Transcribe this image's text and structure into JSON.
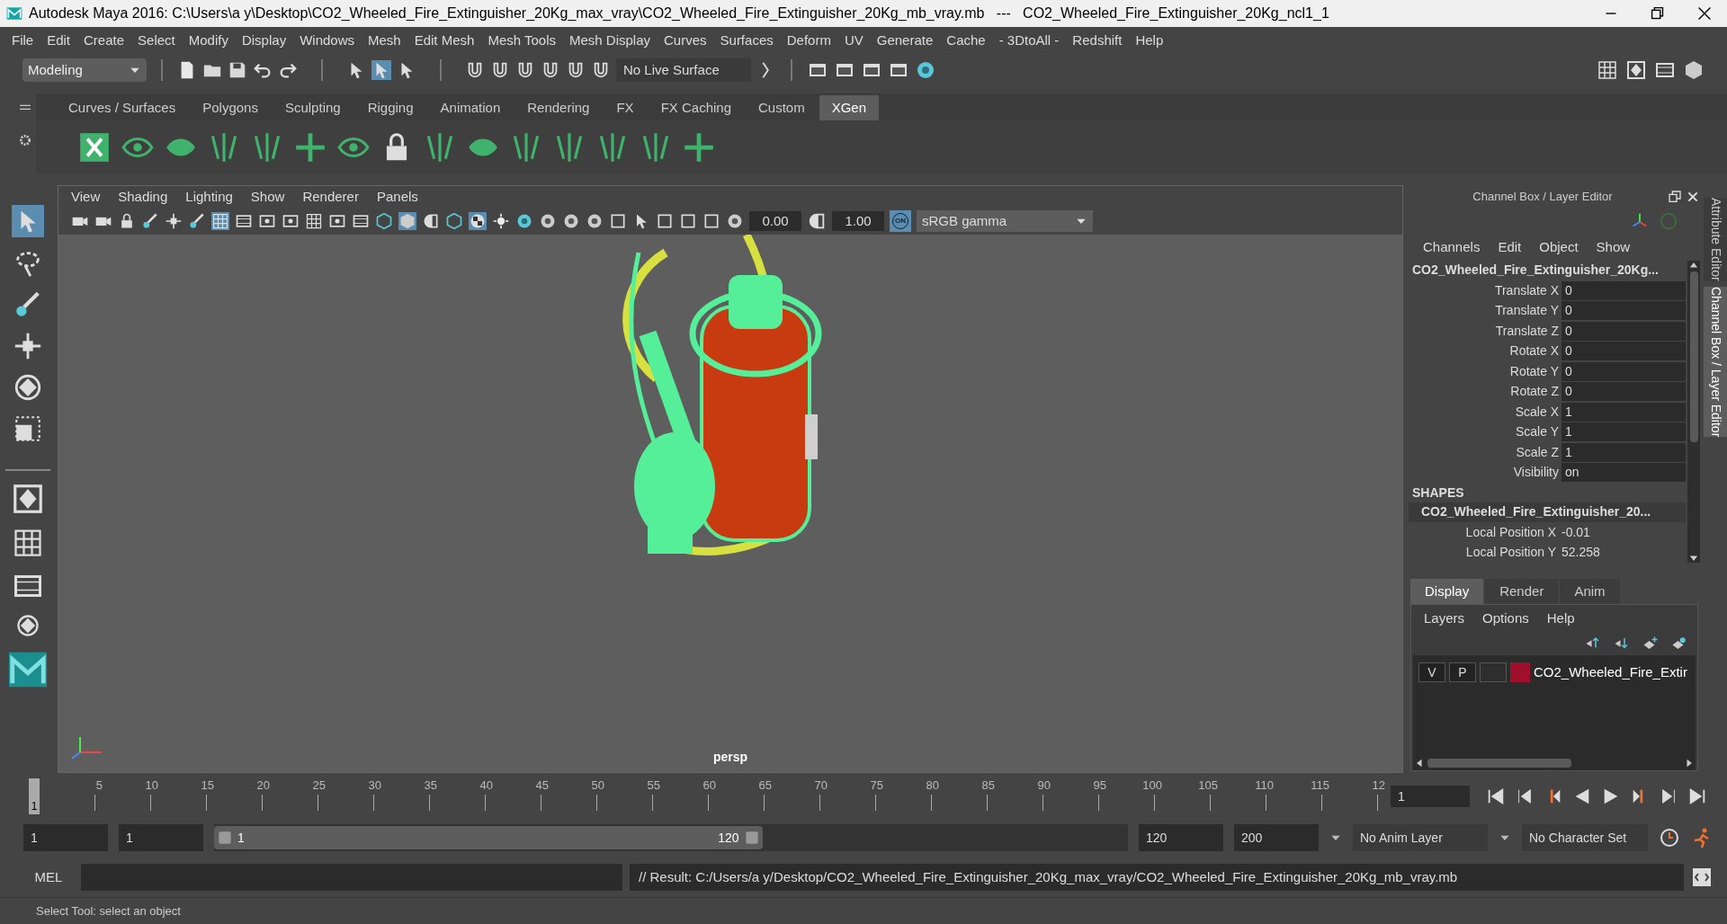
{
  "window": {
    "title": "Autodesk Maya 2016: C:\\Users\\a y\\Desktop\\CO2_Wheeled_Fire_Extinguisher_20Kg_max_vray\\CO2_Wheeled_Fire_Extinguisher_20Kg_mb_vray.mb   ---   CO2_Wheeled_Fire_Extinguisher_20Kg_ncl1_1"
  },
  "menu_bar": [
    "File",
    "Edit",
    "Create",
    "Select",
    "Modify",
    "Display",
    "Windows",
    "Mesh",
    "Edit Mesh",
    "Mesh Tools",
    "Mesh Display",
    "Curves",
    "Surfaces",
    "Deform",
    "UV",
    "Generate",
    "Cache",
    "- 3DtoAll -",
    "Redshift",
    "Help"
  ],
  "status_line": {
    "mode": "Modeling",
    "live_surface": "No Live Surface"
  },
  "shelf": {
    "tabs": [
      {
        "label": "Curves / Surfaces",
        "selected": false
      },
      {
        "label": "Polygons",
        "selected": false
      },
      {
        "label": "Sculpting",
        "selected": false
      },
      {
        "label": "Rigging",
        "selected": false
      },
      {
        "label": "Animation",
        "selected": false
      },
      {
        "label": "Rendering",
        "selected": false
      },
      {
        "label": "FX",
        "selected": false
      },
      {
        "label": "FX Caching",
        "selected": false
      },
      {
        "label": "Custom",
        "selected": false
      },
      {
        "label": "XGen",
        "selected": true
      }
    ]
  },
  "viewport": {
    "menu": [
      "View",
      "Shading",
      "Lighting",
      "Show",
      "Renderer",
      "Panels"
    ],
    "exposure": "0.00",
    "gamma": "1.00",
    "color_management": "ON",
    "color_space": "sRGB gamma",
    "camera": "persp"
  },
  "channel_box": {
    "title": "Channel Box / Layer Editor",
    "menu": [
      "Channels",
      "Edit",
      "Object",
      "Show"
    ],
    "object_name": "CO2_Wheeled_Fire_Extinguisher_20Kg...",
    "channels": [
      {
        "name": "Translate X",
        "value": "0"
      },
      {
        "name": "Translate Y",
        "value": "0"
      },
      {
        "name": "Translate Z",
        "value": "0"
      },
      {
        "name": "Rotate X",
        "value": "0"
      },
      {
        "name": "Rotate Y",
        "value": "0"
      },
      {
        "name": "Rotate Z",
        "value": "0"
      },
      {
        "name": "Scale X",
        "value": "1"
      },
      {
        "name": "Scale Y",
        "value": "1"
      },
      {
        "name": "Scale Z",
        "value": "1"
      },
      {
        "name": "Visibility",
        "value": "on"
      }
    ],
    "shapes_header": "SHAPES",
    "shape_name": "CO2_Wheeled_Fire_Extinguisher_20...",
    "shape_channels": [
      {
        "name": "Local Position X",
        "value": "-0.01"
      },
      {
        "name": "Local Position Y",
        "value": "52.258"
      }
    ]
  },
  "side_tabs": [
    {
      "label": "Attribute Editor",
      "selected": false
    },
    {
      "label": "Channel Box / Layer Editor",
      "selected": true
    }
  ],
  "layer_editor": {
    "tabs": [
      {
        "label": "Display",
        "selected": true
      },
      {
        "label": "Render",
        "selected": false
      },
      {
        "label": "Anim",
        "selected": false
      }
    ],
    "menu": [
      "Layers",
      "Options",
      "Help"
    ],
    "layers": [
      {
        "visible": "V",
        "playback": "P",
        "color": "#a0102a",
        "name": "CO2_Wheeled_Fire_Extir"
      }
    ]
  },
  "timeline": {
    "ticks": [
      "5",
      "10",
      "15",
      "20",
      "25",
      "30",
      "35",
      "40",
      "45",
      "50",
      "55",
      "60",
      "65",
      "70",
      "75",
      "80",
      "85",
      "90",
      "95",
      "100",
      "105",
      "110",
      "115",
      "12"
    ],
    "current_marker": "1",
    "current_frame": "1"
  },
  "range": {
    "level": 0.6,
    "start": "1",
    "playback_start": "1",
    "slider_start": "1",
    "slider_end": "120",
    "playback_end": "120",
    "end": "200",
    "anim_layer": "No Anim Layer",
    "character_set": "No Character Set"
  },
  "command_line": {
    "language": "MEL",
    "result": "// Result: C:/Users/a y/Desktop/CO2_Wheeled_Fire_Extinguisher_20Kg_max_vray/CO2_Wheeled_Fire_Extinguisher_20Kg_mb_vray.mb"
  },
  "help_line": "Select Tool: select an object"
}
